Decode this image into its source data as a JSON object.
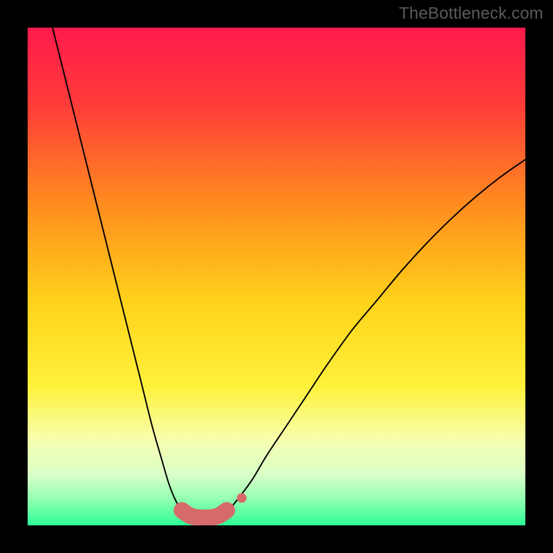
{
  "watermark": "TheBottleneck.com",
  "chart_data": {
    "type": "line",
    "title": "",
    "xlabel": "",
    "ylabel": "",
    "xlim": [
      0,
      100
    ],
    "ylim": [
      0,
      100
    ],
    "grid": false,
    "legend": false,
    "background_gradient_stops": [
      {
        "offset": 0.0,
        "color": "#ff1a4b"
      },
      {
        "offset": 0.15,
        "color": "#ff3a3a"
      },
      {
        "offset": 0.35,
        "color": "#ff8a1f"
      },
      {
        "offset": 0.55,
        "color": "#ffd21a"
      },
      {
        "offset": 0.72,
        "color": "#fff13a"
      },
      {
        "offset": 0.83,
        "color": "#f6ffb0"
      },
      {
        "offset": 0.9,
        "color": "#d8ffc8"
      },
      {
        "offset": 0.95,
        "color": "#8effae"
      },
      {
        "offset": 1.0,
        "color": "#2cff98"
      }
    ],
    "series": [
      {
        "name": "left-curve",
        "color": "#000000",
        "width": 2.0,
        "x": [
          5,
          7,
          9,
          11,
          13,
          15,
          17,
          19,
          21,
          23,
          25,
          27,
          28.5,
          30,
          31.5
        ],
        "y": [
          100,
          92,
          84,
          76,
          68,
          60,
          52,
          44,
          36,
          28,
          20,
          13,
          8,
          4.5,
          2.5
        ]
      },
      {
        "name": "right-curve",
        "color": "#000000",
        "width": 2.0,
        "x": [
          40,
          42,
          45,
          48,
          52,
          56,
          60,
          65,
          70,
          75,
          80,
          85,
          90,
          95,
          100
        ],
        "y": [
          2.5,
          5,
          9,
          14,
          20,
          26,
          32,
          39,
          45,
          51,
          56.5,
          61.5,
          66,
          70,
          73.5
        ]
      },
      {
        "name": "floor-band",
        "color": "#d66a6a",
        "type": "marker-band",
        "marker_radius": 12,
        "x": [
          31,
          32.5,
          34,
          35.5,
          37,
          38.5,
          40
        ],
        "y": [
          3,
          2,
          1.6,
          1.5,
          1.6,
          2,
          3
        ],
        "extra_marker": {
          "x": 43,
          "y": 5.5,
          "r": 7
        }
      }
    ]
  }
}
